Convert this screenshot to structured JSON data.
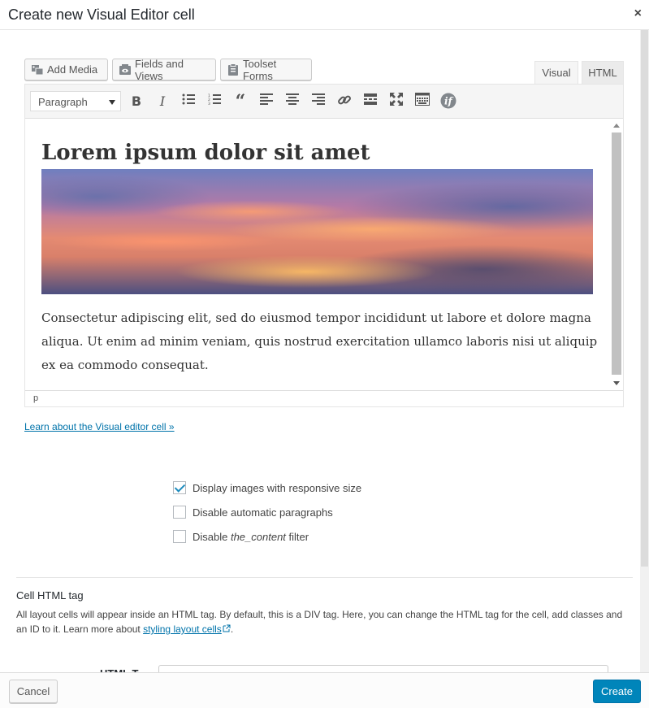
{
  "dialog": {
    "title": "Create new Visual Editor cell",
    "close_label": "×"
  },
  "media_buttons": {
    "add_media": "Add Media",
    "fields_and_views": "Fields and Views",
    "toolset_forms": "Toolset Forms"
  },
  "editor_tabs": {
    "visual": "Visual",
    "html": "HTML"
  },
  "toolbar": {
    "format_selected": "Paragraph",
    "buttons": [
      "bold",
      "italic",
      "bulleted-list",
      "numbered-list",
      "blockquote",
      "align-left",
      "align-center",
      "align-right",
      "insert-link",
      "read-more",
      "fullscreen",
      "toolbar-toggle",
      "conditional"
    ]
  },
  "content": {
    "heading": "Lorem ipsum dolor sit amet",
    "paragraph": "Consectetur adipiscing elit, sed do eiusmod tempor incididunt ut labore et dolore magna aliqua. Ut enim ad minim veniam, quis nostrud exercitation ullamco laboris nisi ut aliquip ex ea commodo consequat."
  },
  "statusbar": {
    "path": "p"
  },
  "learn_link": "Learn about the Visual editor cell »",
  "options": [
    {
      "label": "Display images with responsive size",
      "checked": true
    },
    {
      "label": "Disable automatic paragraphs",
      "checked": false
    },
    {
      "label_pre": "Disable ",
      "label_em": "the_content",
      "label_post": " filter",
      "checked": false
    }
  ],
  "cell_html_tag": {
    "title": "Cell HTML tag",
    "description": "All layout cells will appear inside an HTML tag. By default, this is a DIV tag. Here, you can change the HTML tag for the cell, add classes and an ID to it. Learn more about ",
    "link_text": "styling layout cells",
    "description_end": ".",
    "field_label": "HTML T"
  },
  "footer": {
    "cancel": "Cancel",
    "create": "Create"
  },
  "colors": {
    "primary": "#0085ba",
    "link": "#0073aa"
  }
}
